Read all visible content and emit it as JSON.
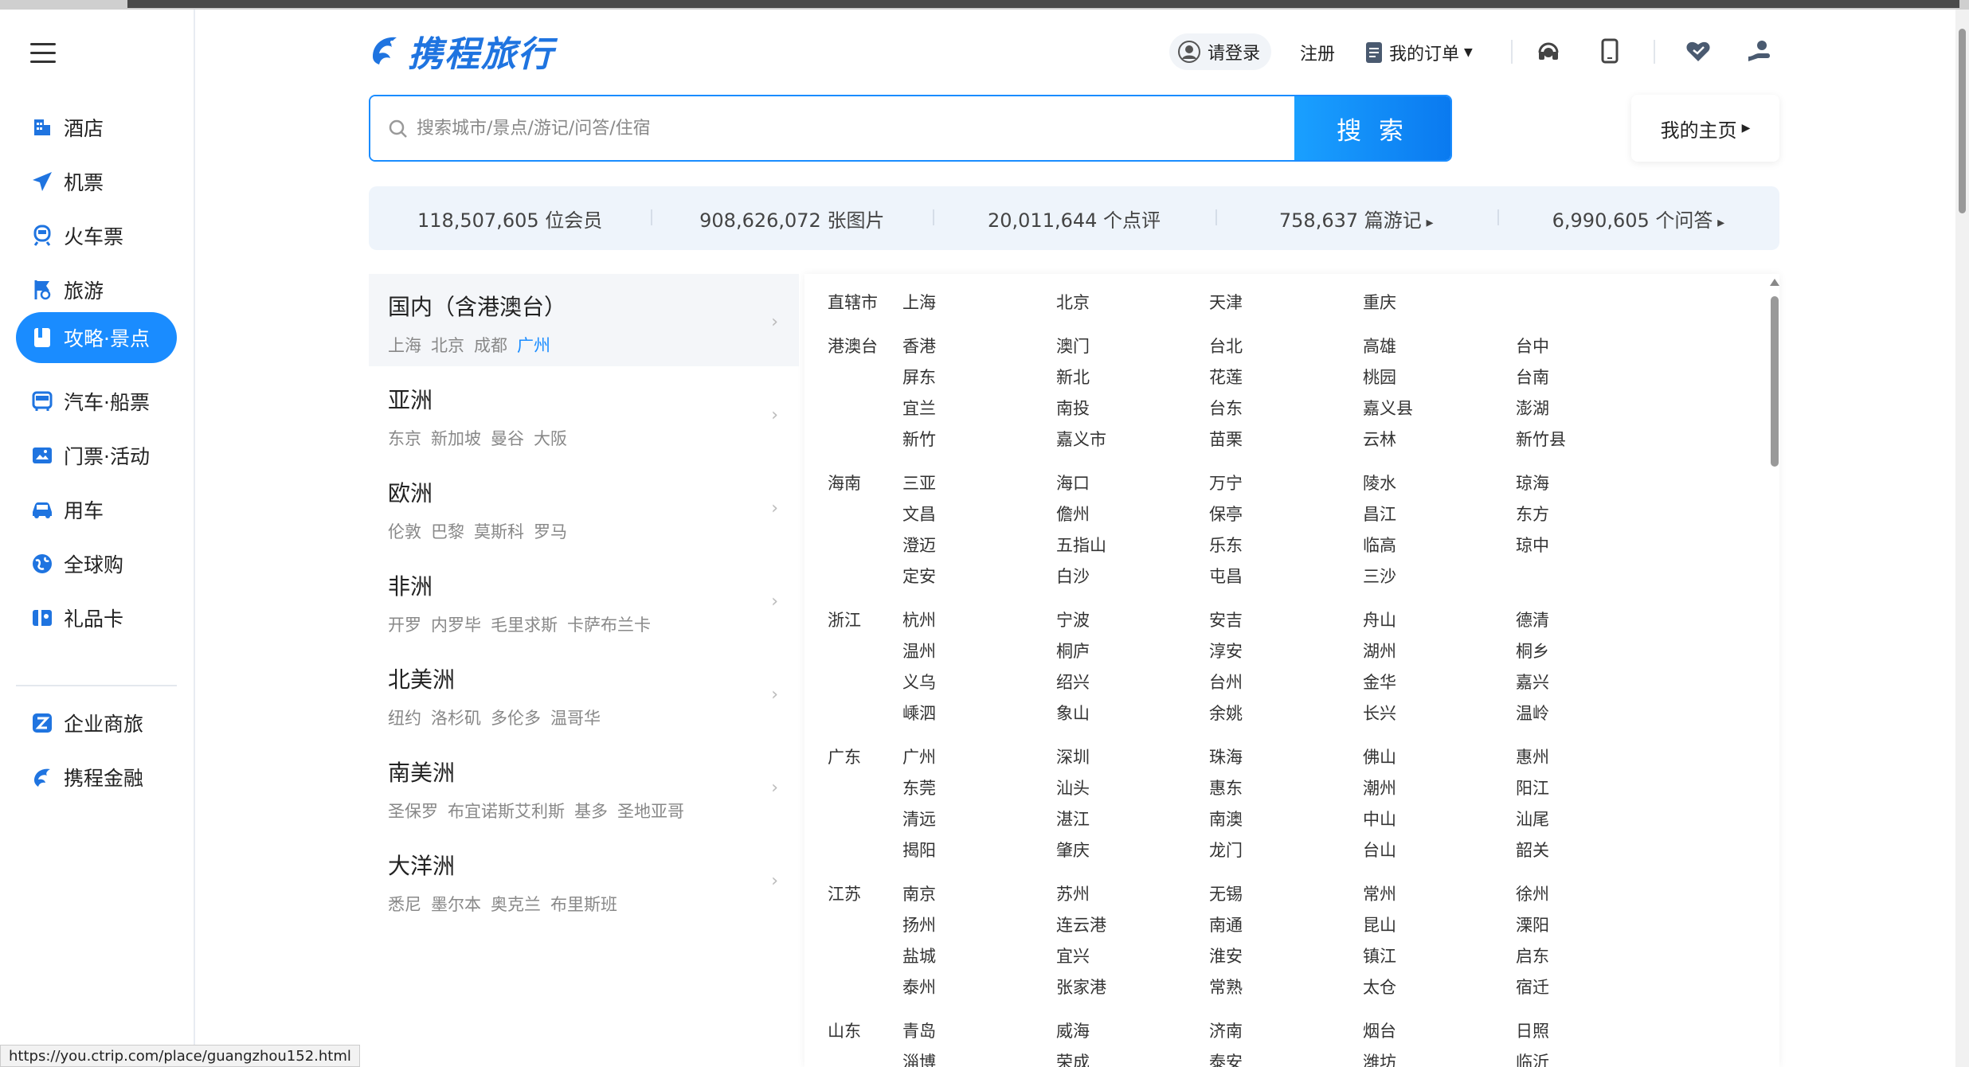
{
  "sidebar": {
    "items": [
      {
        "label": "酒店",
        "icon": "hotel-icon"
      },
      {
        "label": "机票",
        "icon": "plane-icon"
      },
      {
        "label": "火车票",
        "icon": "train-icon"
      },
      {
        "label": "旅游",
        "icon": "travel-flag-icon"
      },
      {
        "label": "攻略·景点",
        "icon": "guidebook-icon",
        "active": true
      },
      {
        "label": "汽车·船票",
        "icon": "bus-icon"
      },
      {
        "label": "门票·活动",
        "icon": "ticket-icon"
      },
      {
        "label": "用车",
        "icon": "car-icon"
      },
      {
        "label": "全球购",
        "icon": "globe-shop-icon"
      },
      {
        "label": "礼品卡",
        "icon": "gift-card-icon"
      }
    ],
    "extra_items": [
      {
        "label": "企业商旅",
        "icon": "business-travel-icon"
      },
      {
        "label": "携程金融",
        "icon": "ctrip-finance-icon"
      }
    ]
  },
  "header": {
    "logo_text": "携程旅行",
    "login_label": "请登录",
    "register_label": "注册",
    "orders_label": "我的订单",
    "accent": "#1a8cff"
  },
  "search": {
    "placeholder": "搜索城市/景点/游记/问答/住宿",
    "button_label": "搜 索",
    "my_home_label": "我的主页"
  },
  "stats": [
    {
      "text": "118,507,605 位会员",
      "arrow": false
    },
    {
      "text": "908,626,072 张图片",
      "arrow": false
    },
    {
      "text": "20,011,644 个点评",
      "arrow": false
    },
    {
      "text": "758,637 篇游记",
      "arrow": true
    },
    {
      "text": "6,990,605 个问答",
      "arrow": true
    }
  ],
  "regions": [
    {
      "title": "国内（含港澳台）",
      "cities": [
        "上海",
        "北京",
        "成都",
        "广州"
      ],
      "highlight": "广州",
      "active": true
    },
    {
      "title": "亚洲",
      "cities": [
        "东京",
        "新加坡",
        "曼谷",
        "大阪"
      ]
    },
    {
      "title": "欧洲",
      "cities": [
        "伦敦",
        "巴黎",
        "莫斯科",
        "罗马"
      ]
    },
    {
      "title": "非洲",
      "cities": [
        "开罗",
        "内罗毕",
        "毛里求斯",
        "卡萨布兰卡"
      ]
    },
    {
      "title": "北美洲",
      "cities": [
        "纽约",
        "洛杉矶",
        "多伦多",
        "温哥华"
      ]
    },
    {
      "title": "南美洲",
      "cities": [
        "圣保罗",
        "布宜诺斯艾利斯",
        "基多",
        "圣地亚哥"
      ]
    },
    {
      "title": "大洋洲",
      "cities": [
        "悉尼",
        "墨尔本",
        "奥克兰",
        "布里斯班"
      ]
    }
  ],
  "provinces": [
    {
      "name": "直辖市",
      "cities": [
        "上海",
        "北京",
        "天津",
        "重庆"
      ]
    },
    {
      "name": "港澳台",
      "cities": [
        "香港",
        "澳门",
        "台北",
        "高雄",
        "台中",
        "屏东",
        "新北",
        "花莲",
        "桃园",
        "台南",
        "宜兰",
        "南投",
        "台东",
        "嘉义县",
        "澎湖",
        "新竹",
        "嘉义市",
        "苗栗",
        "云林",
        "新竹县"
      ]
    },
    {
      "name": "海南",
      "cities": [
        "三亚",
        "海口",
        "万宁",
        "陵水",
        "琼海",
        "文昌",
        "儋州",
        "保亭",
        "昌江",
        "东方",
        "澄迈",
        "五指山",
        "乐东",
        "临高",
        "琼中",
        "定安",
        "白沙",
        "屯昌",
        "三沙"
      ]
    },
    {
      "name": "浙江",
      "cities": [
        "杭州",
        "宁波",
        "安吉",
        "舟山",
        "德清",
        "温州",
        "桐庐",
        "淳安",
        "湖州",
        "桐乡",
        "义乌",
        "绍兴",
        "台州",
        "金华",
        "嘉兴",
        "嵊泗",
        "象山",
        "余姚",
        "长兴",
        "温岭"
      ]
    },
    {
      "name": "广东",
      "cities": [
        "广州",
        "深圳",
        "珠海",
        "佛山",
        "惠州",
        "东莞",
        "汕头",
        "惠东",
        "潮州",
        "阳江",
        "清远",
        "湛江",
        "南澳",
        "中山",
        "汕尾",
        "揭阳",
        "肇庆",
        "龙门",
        "台山",
        "韶关"
      ]
    },
    {
      "name": "江苏",
      "cities": [
        "南京",
        "苏州",
        "无锡",
        "常州",
        "徐州",
        "扬州",
        "连云港",
        "南通",
        "昆山",
        "溧阳",
        "盐城",
        "宜兴",
        "淮安",
        "镇江",
        "启东",
        "泰州",
        "张家港",
        "常熟",
        "太仓",
        "宿迁"
      ]
    },
    {
      "name": "山东",
      "cities": [
        "青岛",
        "威海",
        "济南",
        "烟台",
        "日照",
        "淄博",
        "荣成",
        "泰安",
        "潍坊",
        "临沂"
      ]
    }
  ],
  "status_url": "https://you.ctrip.com/place/guangzhou152.html"
}
